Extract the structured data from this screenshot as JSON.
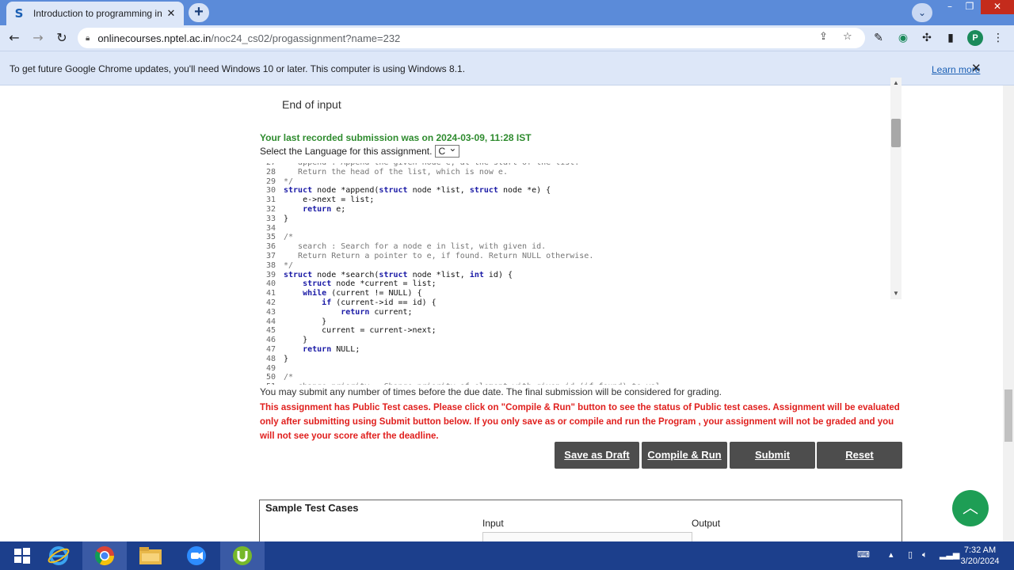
{
  "browser": {
    "tab_title": "Introduction to programming in",
    "tab_favicon": "S",
    "url_host": "onlinecourses.nptel.ac.in",
    "url_path": "/noc24_cs02/progassignment?name=232",
    "profile_initial": "P"
  },
  "infobar": {
    "message": "To get future Google Chrome updates, you'll need Windows 10 or later. This computer is using Windows 8.1.",
    "learn_more": "Learn more"
  },
  "page": {
    "end_of_input": "End of input",
    "last_submission": "Your last recorded submission was on 2024-03-09, 11:28 IST",
    "language_label": "Select the Language for this assignment.",
    "language_value": "C",
    "submit_note": "You may submit any number of times before the due date. The final submission will be considered for grading.",
    "warning": "This assignment has Public Test cases. Please click on \"Compile & Run\" button to see the status of Public test cases. Assignment will be evaluated only after submitting using Submit button below. If you only save as or compile and run the Program , your assignment will not be graded and you will not see your score after the deadline.",
    "buttons": {
      "draft": "Save as Draft",
      "compile": "Compile & Run",
      "submit": "Submit",
      "reset": "Reset"
    },
    "sample": {
      "heading": "Sample Test Cases",
      "input": "Input",
      "output": "Output"
    }
  },
  "code_lines": [
    {
      "n": "27",
      "t": "   append : Append the given node e, at the start of the list."
    },
    {
      "n": "28",
      "t": "   Return the head of the list, which is now e."
    },
    {
      "n": "29",
      "t": "*/"
    },
    {
      "n": "30",
      "t": "struct node *append(struct node *list, struct node *e) {"
    },
    {
      "n": "31",
      "t": "    e->next = list;"
    },
    {
      "n": "32",
      "t": "    return e;"
    },
    {
      "n": "33",
      "t": "}"
    },
    {
      "n": "34",
      "t": ""
    },
    {
      "n": "35",
      "t": "/*"
    },
    {
      "n": "36",
      "t": "   search : Search for a node e in list, with given id."
    },
    {
      "n": "37",
      "t": "   Return Return a pointer to e, if found. Return NULL otherwise."
    },
    {
      "n": "38",
      "t": "*/"
    },
    {
      "n": "39",
      "t": "struct node *search(struct node *list, int id) {"
    },
    {
      "n": "40",
      "t": "    struct node *current = list;"
    },
    {
      "n": "41",
      "t": "    while (current != NULL) {"
    },
    {
      "n": "42",
      "t": "        if (current->id == id) {"
    },
    {
      "n": "43",
      "t": "            return current;"
    },
    {
      "n": "44",
      "t": "        }"
    },
    {
      "n": "45",
      "t": "        current = current->next;"
    },
    {
      "n": "46",
      "t": "    }"
    },
    {
      "n": "47",
      "t": "    return NULL;"
    },
    {
      "n": "48",
      "t": "}"
    },
    {
      "n": "49",
      "t": ""
    },
    {
      "n": "50",
      "t": "/*"
    },
    {
      "n": "51",
      "t": "   change_priority : Change priority of element with given id (if found) to val"
    }
  ],
  "taskbar": {
    "time": "7:32 AM",
    "date": "3/20/2024"
  },
  "colors": {
    "chrome_accent": "#5b8bd9",
    "success_green": "#2e8b2e",
    "warning_red": "#e0201e",
    "button_gray": "#4d4d4d",
    "fab_green": "#1e9e55"
  }
}
